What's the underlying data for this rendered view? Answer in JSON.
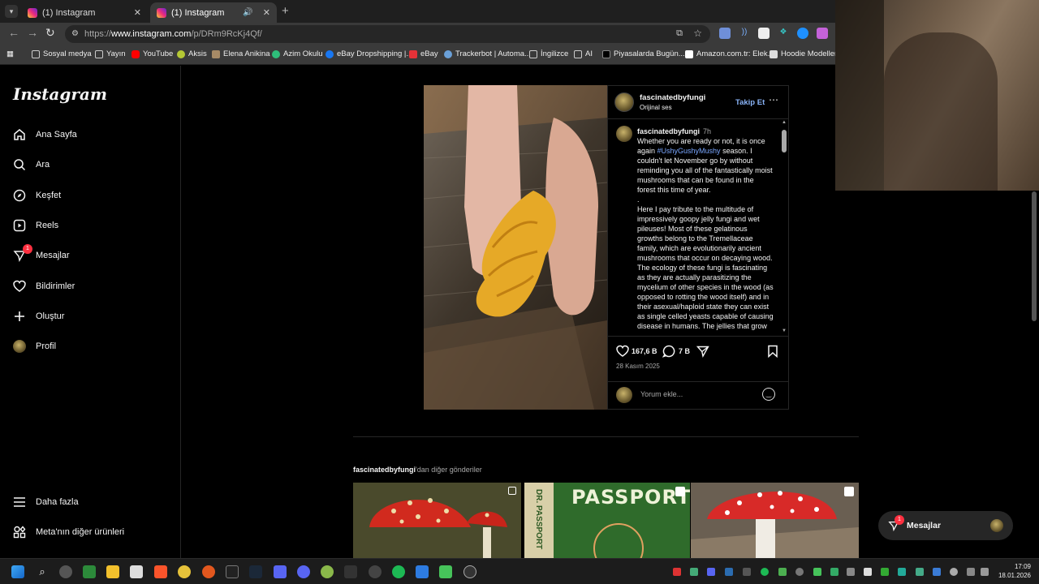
{
  "browser": {
    "tabs": [
      {
        "title": "(1) Instagram",
        "active": false
      },
      {
        "title": "(1) Instagram",
        "active": true
      }
    ],
    "url_prefix": "https://",
    "url_host": "www.instagram.com",
    "url_path": "/p/DRm9RcKj4Qf/",
    "bookmarks": [
      "Sosyal medya",
      "Yayın",
      "YouTube",
      "Aksis",
      "Elena Anikina",
      "Azim Okulu",
      "eBay Dropshipping |...",
      "eBay",
      "Trackerbot | Automa...",
      "İngilizce",
      "AI",
      "Piyasalarda Bugün...",
      "Amazon.com.tr: Elek...",
      "Hoodie Modelleri |"
    ]
  },
  "sidebar": {
    "logo": "Instagram",
    "items": [
      {
        "label": "Ana Sayfa",
        "icon": "home-icon"
      },
      {
        "label": "Ara",
        "icon": "search-icon"
      },
      {
        "label": "Keşfet",
        "icon": "compass-icon"
      },
      {
        "label": "Reels",
        "icon": "reels-icon"
      },
      {
        "label": "Mesajlar",
        "icon": "messenger-icon",
        "badge": "1"
      },
      {
        "label": "Bildirimler",
        "icon": "heart-icon"
      },
      {
        "label": "Oluştur",
        "icon": "plus-icon"
      },
      {
        "label": "Profil",
        "icon": "avatar"
      }
    ],
    "more": "Daha fazla",
    "meta": "Meta'nın diğer ürünleri"
  },
  "post": {
    "username": "fascinatedbyfungi",
    "audio": "Orijinal ses",
    "follow": "Takip Et",
    "time": "7h",
    "caption_p1_a": "Whether you are ready or not, it is once again ",
    "hashtag": "#UshyGushyMushy",
    "caption_p1_b": " season. I couldn't let November go by without reminding you all of the fantastically moist mushrooms that can be found in the forest this time of year.",
    "caption_dot": ".",
    "caption_p2": "Here I pay tribute to the multitude of impressively goopy jelly fungi and wet pileuses! Most of these gelatinous growths belong to the Tremellaceae family, which are evolutionarily ancient mushrooms that occur on decaying wood. The ecology of these fungi is fascinating as they are actually parasitizing the mycelium of other species in the wood (as opposed to rotting the wood itself) and in their asexual/haploid state they can exist as single celled yeasts capable of causing disease in humans. The jellies that grow",
    "likes": "167,6 B",
    "comments": "7 B",
    "date": "28 Kasım 2025",
    "comment_placeholder": "Yorum ekle..."
  },
  "more_posts": {
    "user": "fascinatedbyfungi",
    "suffix": "'dan diğer gönderiler",
    "passport_text": "PASSPORT",
    "passport_side": "DR. PASSPORT"
  },
  "messages_pill": {
    "label": "Mesajlar",
    "badge": "1"
  },
  "taskbar": {
    "time": "17:09",
    "date": "18.01.2026"
  },
  "colors": {
    "accent": "#0095f6",
    "follow": "#8ab4f8",
    "badge": "#ff3040",
    "hashtag": "#7aa7ff"
  }
}
